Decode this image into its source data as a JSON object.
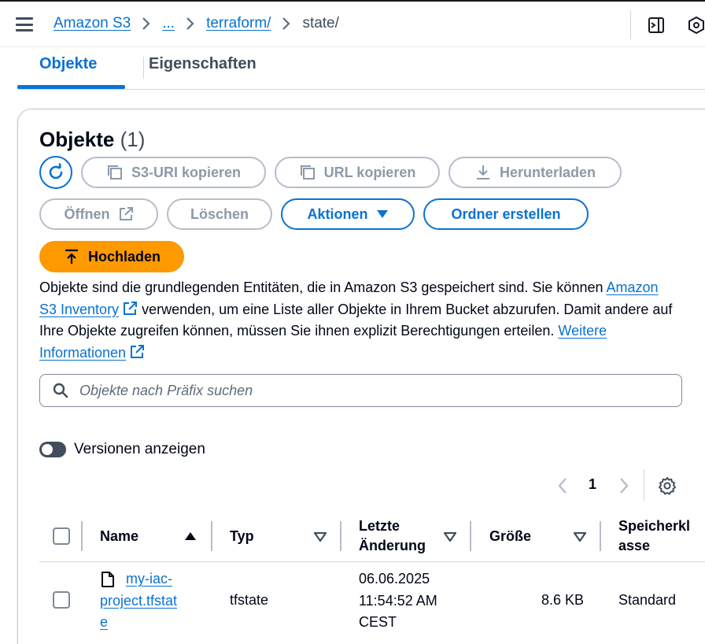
{
  "breadcrumb": {
    "items": [
      "Amazon S3",
      "...",
      "terraform/"
    ],
    "current": "state/"
  },
  "tabs": [
    {
      "label": "Objekte",
      "active": true
    },
    {
      "label": "Eigenschaften",
      "active": false
    }
  ],
  "panel": {
    "title": "Objekte",
    "count": "(1)"
  },
  "buttons": {
    "copy_s3_uri": "S3-URI kopieren",
    "copy_url": "URL kopieren",
    "download": "Herunterladen",
    "open": "Öffnen",
    "delete": "Löschen",
    "actions": "Aktionen",
    "create_folder": "Ordner erstellen",
    "upload": "Hochladen"
  },
  "description": {
    "part1": "Objekte sind die grundlegenden Entitäten, die in Amazon S3 gespeichert sind. Sie können ",
    "link1": "Amazon S3 Inventory",
    "part2": " verwenden, um eine Liste aller Objekte in Ihrem Bucket abzurufen. Damit andere auf Ihre Objekte zugreifen können, müssen Sie ihnen explizit Berechtigungen erteilen. ",
    "link2": "Weitere Informationen"
  },
  "search": {
    "placeholder": "Objekte nach Präfix suchen"
  },
  "versions_toggle": {
    "label": "Versionen anzeigen",
    "on": false
  },
  "pagination": {
    "current_page": "1"
  },
  "table": {
    "columns": {
      "name": "Name",
      "type": "Typ",
      "modified_line1": "Letzte",
      "modified_line2": "Änderung",
      "size": "Größe",
      "storage_line1": "Speicherkl",
      "storage_line2": "asse"
    },
    "rows": [
      {
        "name_line1": "my-iac-",
        "name_line2": "project.tfstat",
        "name_line3": "e",
        "type": "tfstate",
        "modified_line1": "06.06.2025",
        "modified_line2": "11:54:52 AM",
        "modified_line3": "CEST",
        "size": "8.6 KB",
        "storage_class": "Standard"
      }
    ]
  },
  "colors": {
    "accent": "#0972d3",
    "upload": "#ff9900",
    "disabled": "#8d99a8"
  }
}
